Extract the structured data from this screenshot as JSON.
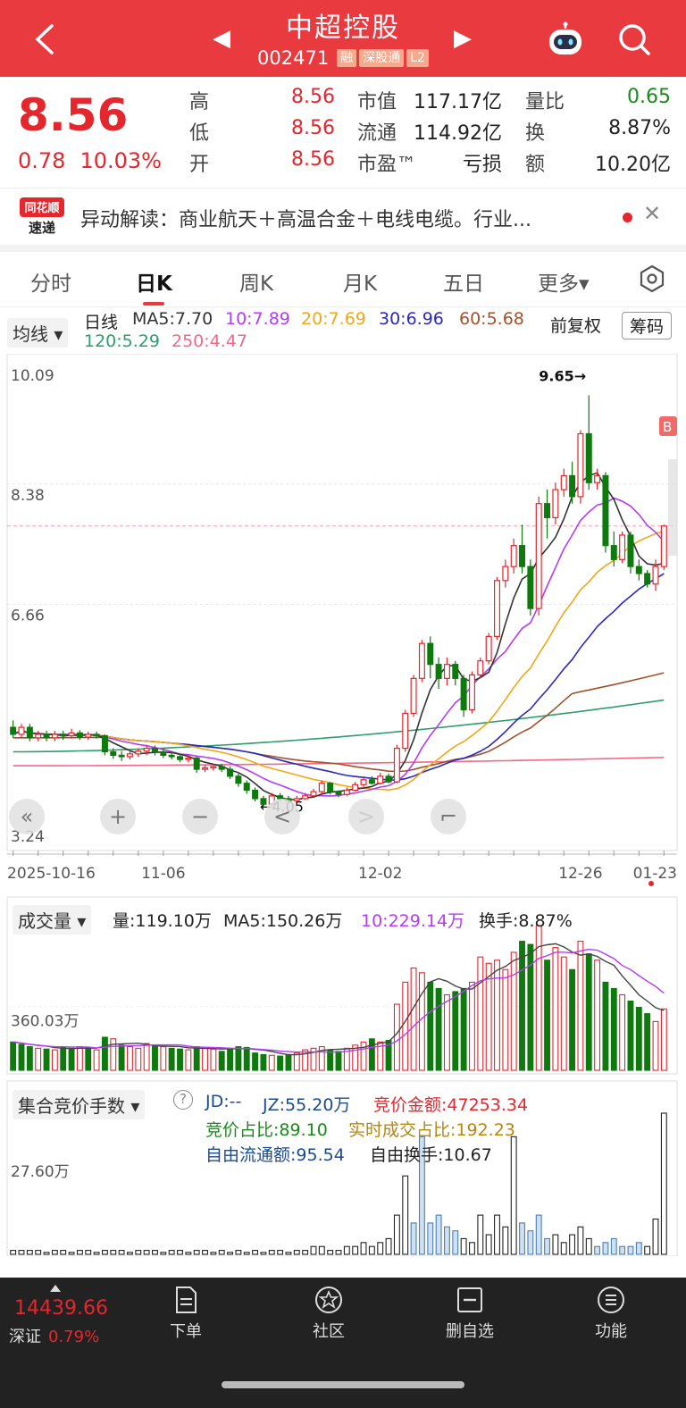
{
  "header": {
    "title": "中超控股",
    "code": "002471",
    "tags": [
      "融",
      "深股通",
      "L2"
    ]
  },
  "quote": {
    "price": "8.56",
    "change": "0.78",
    "change_pct": "10.03%",
    "high_label": "高",
    "high": "8.56",
    "low_label": "低",
    "low": "8.56",
    "open_label": "开",
    "open": "8.56",
    "mktcap_label": "市值",
    "mktcap": "117.17亿",
    "float_label": "流通",
    "float": "114.92亿",
    "pe_label": "市盈™",
    "pe": "亏损",
    "volratio_label": "量比",
    "volratio": "0.65",
    "turnover_label": "换",
    "turnover": "8.87%",
    "amount_label": "额",
    "amount": "10.20亿"
  },
  "news": {
    "logo_top": "同花顺",
    "logo_bottom": "速递",
    "text": "异动解读：商业航天＋高温合金＋电线电缆。行业..."
  },
  "tabs": [
    "分时",
    "日K",
    "周K",
    "月K",
    "五日",
    "更多▾"
  ],
  "ma_bar": {
    "dropdown": "均线",
    "line_type": "日线",
    "ma5": "MA5:7.70",
    "ma10": "10:7.89",
    "ma20": "20:7.69",
    "ma30": "30:6.96",
    "ma60": "60:5.68",
    "ma120": "120:5.29",
    "ma250": "250:4.47",
    "adjust": "前复权",
    "chip_button": "筹码"
  },
  "colors": {
    "up": "#e4262d",
    "down": "#0e7a0e",
    "ma5": "#333333",
    "ma10": "#b53cf0",
    "ma20": "#f0a818",
    "ma30": "#2a2ab8",
    "ma60": "#a0522d",
    "ma120": "#2e9e6a",
    "ma250": "#f06a86"
  },
  "chart_data": [
    {
      "type": "candlestick",
      "ylim": [
        3.24,
        10.09
      ],
      "y_ticks": [
        "10.09",
        "8.38",
        "6.66",
        "3.24"
      ],
      "x_ticks": [
        "2025-10-16",
        "11-06",
        "12-02",
        "12-26",
        "01-23"
      ],
      "annotations": {
        "high": "9.65→",
        "low": "←4.05",
        "marker": "B"
      },
      "candles": [
        [
          4.9,
          4.8,
          5.0,
          4.75
        ],
        [
          4.8,
          4.9,
          4.95,
          4.75
        ],
        [
          4.9,
          4.75,
          4.95,
          4.7
        ],
        [
          4.75,
          4.8,
          4.85,
          4.7
        ],
        [
          4.8,
          4.75,
          4.85,
          4.7
        ],
        [
          4.75,
          4.8,
          4.85,
          4.7
        ],
        [
          4.8,
          4.78,
          4.85,
          4.72
        ],
        [
          4.78,
          4.82,
          4.88,
          4.74
        ],
        [
          4.82,
          4.76,
          4.86,
          4.72
        ],
        [
          4.76,
          4.8,
          4.84,
          4.72
        ],
        [
          4.8,
          4.78,
          4.84,
          4.74
        ],
        [
          4.78,
          4.55,
          4.8,
          4.5
        ],
        [
          4.55,
          4.5,
          4.6,
          4.45
        ],
        [
          4.5,
          4.48,
          4.56,
          4.42
        ],
        [
          4.48,
          4.52,
          4.58,
          4.44
        ],
        [
          4.52,
          4.56,
          4.6,
          4.48
        ],
        [
          4.56,
          4.6,
          4.65,
          4.5
        ],
        [
          4.6,
          4.55,
          4.64,
          4.5
        ],
        [
          4.55,
          4.5,
          4.6,
          4.46
        ],
        [
          4.5,
          4.48,
          4.56,
          4.44
        ],
        [
          4.48,
          4.44,
          4.52,
          4.4
        ],
        [
          4.44,
          4.46,
          4.5,
          4.4
        ],
        [
          4.46,
          4.3,
          4.48,
          4.25
        ],
        [
          4.3,
          4.32,
          4.36,
          4.26
        ],
        [
          4.32,
          4.34,
          4.38,
          4.28
        ],
        [
          4.34,
          4.3,
          4.38,
          4.26
        ],
        [
          4.3,
          4.2,
          4.34,
          4.16
        ],
        [
          4.2,
          4.1,
          4.24,
          4.05
        ],
        [
          4.1,
          4.0,
          4.14,
          3.95
        ],
        [
          4.0,
          3.88,
          4.04,
          3.84
        ],
        [
          3.88,
          3.8,
          3.92,
          3.75
        ],
        [
          3.8,
          3.92,
          3.96,
          3.78
        ],
        [
          3.92,
          3.88,
          3.96,
          3.84
        ],
        [
          3.88,
          3.85,
          3.92,
          3.82
        ],
        [
          3.85,
          3.88,
          3.92,
          3.82
        ],
        [
          3.88,
          3.92,
          3.96,
          3.86
        ],
        [
          3.92,
          3.98,
          4.02,
          3.9
        ],
        [
          3.98,
          4.1,
          4.14,
          3.95
        ],
        [
          4.1,
          3.98,
          4.12,
          3.94
        ],
        [
          3.98,
          3.94,
          4.0,
          3.9
        ],
        [
          3.94,
          4.0,
          4.04,
          3.92
        ],
        [
          4.0,
          4.08,
          4.12,
          3.98
        ],
        [
          4.08,
          4.15,
          4.2,
          4.04
        ],
        [
          4.15,
          4.1,
          4.2,
          4.08
        ],
        [
          4.1,
          4.2,
          4.25,
          4.08
        ],
        [
          4.2,
          4.12,
          4.24,
          4.1
        ],
        [
          4.12,
          4.6,
          4.65,
          4.1
        ],
        [
          4.6,
          5.1,
          5.15,
          4.55
        ],
        [
          5.1,
          5.6,
          5.65,
          5.05
        ],
        [
          5.6,
          6.1,
          6.15,
          5.55
        ],
        [
          6.1,
          5.8,
          6.2,
          5.6
        ],
        [
          5.8,
          5.6,
          5.9,
          5.45
        ],
        [
          5.6,
          5.8,
          5.9,
          5.5
        ],
        [
          5.8,
          5.6,
          5.85,
          5.5
        ],
        [
          5.6,
          5.15,
          5.65,
          5.05
        ],
        [
          5.15,
          5.65,
          5.7,
          5.1
        ],
        [
          5.65,
          5.85,
          5.9,
          5.6
        ],
        [
          5.85,
          6.2,
          6.25,
          5.8
        ],
        [
          6.2,
          7.0,
          7.05,
          6.15
        ],
        [
          7.0,
          7.2,
          7.3,
          6.9
        ],
        [
          7.2,
          7.5,
          7.6,
          7.1
        ],
        [
          7.5,
          7.2,
          7.8,
          7.1
        ],
        [
          7.2,
          6.6,
          7.3,
          6.5
        ],
        [
          6.6,
          8.1,
          8.2,
          6.5
        ],
        [
          8.1,
          7.9,
          8.3,
          7.6
        ],
        [
          7.9,
          8.3,
          8.4,
          7.8
        ],
        [
          8.3,
          8.5,
          8.6,
          8.2
        ],
        [
          8.5,
          8.2,
          8.7,
          8.1
        ],
        [
          8.2,
          9.1,
          9.15,
          8.1
        ],
        [
          9.1,
          8.4,
          9.65,
          8.3
        ],
        [
          8.4,
          8.5,
          8.6,
          8.3
        ],
        [
          8.5,
          7.5,
          8.55,
          7.4
        ],
        [
          7.5,
          7.3,
          7.7,
          7.2
        ],
        [
          7.3,
          7.65,
          7.7,
          7.25
        ],
        [
          7.65,
          7.2,
          7.7,
          7.1
        ],
        [
          7.2,
          7.1,
          7.3,
          7.0
        ],
        [
          7.1,
          6.95,
          7.15,
          6.9
        ],
        [
          6.95,
          7.2,
          7.3,
          6.85
        ],
        [
          7.2,
          7.78,
          7.8,
          7.15
        ]
      ]
    },
    {
      "type": "bar",
      "title": "成交量",
      "stats": {
        "vol": "量:119.10万",
        "ma5": "MA5:150.26万",
        "ma10": "10:229.14万",
        "turnover": "换手:8.87%"
      },
      "y_ticks": [
        "360.03万"
      ],
      "values": [
        180,
        165,
        150,
        140,
        135,
        130,
        145,
        140,
        150,
        140,
        130,
        210,
        200,
        160,
        150,
        140,
        170,
        160,
        150,
        140,
        135,
        130,
        150,
        140,
        135,
        120,
        140,
        150,
        145,
        110,
        100,
        95,
        90,
        100,
        110,
        130,
        140,
        150,
        130,
        120,
        140,
        160,
        180,
        200,
        180,
        190,
        420,
        560,
        650,
        620,
        560,
        520,
        480,
        500,
        520,
        560,
        720,
        680,
        700,
        640,
        750,
        820,
        800,
        920,
        700,
        780,
        720,
        640,
        820,
        740,
        700,
        560,
        520,
        480,
        440,
        400,
        360,
        310,
        390
      ],
      "up": [
        0,
        0,
        0,
        1,
        0,
        1,
        0,
        0,
        1,
        0,
        1,
        0,
        1,
        0,
        1,
        1,
        1,
        0,
        1,
        0,
        0,
        1,
        0,
        1,
        1,
        0,
        0,
        0,
        0,
        0,
        0,
        1,
        0,
        0,
        1,
        1,
        1,
        1,
        0,
        0,
        1,
        1,
        1,
        0,
        1,
        0,
        1,
        1,
        1,
        1,
        0,
        0,
        1,
        0,
        0,
        1,
        1,
        1,
        1,
        1,
        1,
        0,
        0,
        1,
        0,
        1,
        1,
        0,
        1,
        0,
        1,
        0,
        0,
        1,
        0,
        0,
        0,
        1,
        1
      ]
    },
    {
      "type": "bar",
      "title": "集合竞价手数",
      "stats": {
        "jd": "JD:--",
        "jz": "JZ:55.20万",
        "amount": "竞价金额:47253.34",
        "ratio": "竞价占比:89.10",
        "rt_ratio": "实时成交占比:192.23",
        "free_float": "自由流通额:95.54",
        "free_turnover": "自由换手:10.67"
      },
      "y_ticks": [
        "27.60万"
      ],
      "values": [
        1,
        1,
        1,
        1,
        0.5,
        1,
        1,
        0.5,
        1,
        1,
        0.5,
        1,
        1,
        1,
        0.5,
        1,
        1,
        1,
        0.5,
        1,
        1,
        0.5,
        1,
        1,
        0.5,
        1,
        0.5,
        1,
        0.5,
        1,
        0.5,
        1,
        1,
        0.5,
        1,
        1,
        2,
        2,
        1,
        1,
        2,
        2,
        3,
        2,
        3,
        4,
        10,
        20,
        8,
        30,
        8,
        10,
        7,
        6,
        4,
        3,
        10,
        5,
        10,
        7,
        30,
        8,
        6,
        10,
        4,
        5,
        3,
        5,
        7,
        4,
        2,
        3,
        4,
        2,
        2,
        3,
        2,
        9,
        36
      ]
    }
  ],
  "chart_controls": [
    "«",
    "+",
    "−",
    "<",
    ">",
    "⌐"
  ],
  "bottom": {
    "index_value": "14439.66",
    "index_name": "深证",
    "index_pct": "0.79%",
    "nav": [
      "下单",
      "社区",
      "删自选",
      "功能"
    ]
  }
}
